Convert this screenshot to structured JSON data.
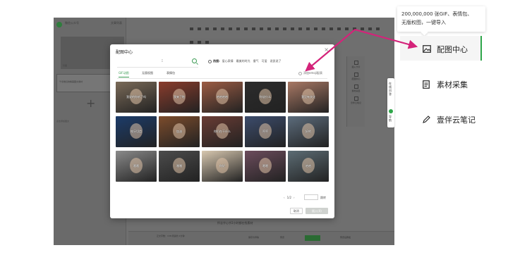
{
  "editor": {
    "brand": "微信公众号",
    "header_right": "文章列表",
    "cover_text": "封面",
    "card_text": "千亲难识的精美图文素材",
    "left_footer": "点击添加图文",
    "bottom_caption": "怀念乎心乎2小时都在找素材",
    "bottom_stats": "正文字数：138 阅读约 1分钟",
    "bottom_buttons": [
      "保存为草稿",
      "预览",
      "群发",
      "预览后群发"
    ],
    "rail_items": [
      "插入卡片",
      "配图中心",
      "素材采集",
      "壹伴云笔记"
    ]
  },
  "side_tab": {
    "text_top": "在线问答",
    "text_bottom": "导航"
  },
  "modal": {
    "title": "配图中心",
    "close": "×",
    "search_mark": "⁝",
    "hot_label": "热搜:",
    "hot_tags": [
      "爱心表情",
      "最美的时光",
      "傻气",
      "可爱",
      "说凯说了"
    ],
    "tabs": [
      "GIF动图",
      "无版权图",
      "表情包"
    ],
    "ugc_toggle": "添加emoji配表",
    "images": [
      {
        "caption": "我说的你听了吗",
        "color": "#7a6a58"
      },
      {
        "caption": "我来了啦",
        "color": "#8a3c2c"
      },
      {
        "caption": "哈哈哈哈",
        "color": "#9c5c44"
      },
      {
        "caption": "你说什么",
        "color": "#2c2c2c"
      },
      {
        "caption": "我没有文化",
        "color": "#a87864"
      },
      {
        "caption": "咬牙切齿",
        "color": "#1c3c6a"
      },
      {
        "caption": "加油",
        "color": "#7c4c2c"
      },
      {
        "caption": "你们在干什么",
        "color": "#6a3c34"
      },
      {
        "caption": "哼哼",
        "color": "#3c4c6c"
      },
      {
        "caption": "好的",
        "color": "#5c6c7c"
      },
      {
        "caption": "哦哦",
        "color": "#8a8a8a"
      },
      {
        "caption": "嘿嘿",
        "color": "#4c4c4c"
      },
      {
        "caption": "你好",
        "color": "#d8c8b0"
      },
      {
        "caption": "嗯嗯",
        "color": "#6c4c5c"
      },
      {
        "caption": "哈哈",
        "color": "#5c6c74"
      }
    ],
    "pager": {
      "prev": "‹",
      "page": "1/2",
      "next": "›",
      "go": "跳转"
    },
    "cancel": "取消",
    "confirm": "插入(0)"
  },
  "tooltip": {
    "line1": "200,000,000 张GIF、表情包、",
    "line2": "无版权图，一键导入"
  },
  "menu": {
    "peitu": "配图中心",
    "sucai": "素材采集",
    "biji": "壹伴云笔记"
  },
  "colors": {
    "accent_green": "#2fa64a",
    "arrow_magenta": "#d4237a"
  }
}
